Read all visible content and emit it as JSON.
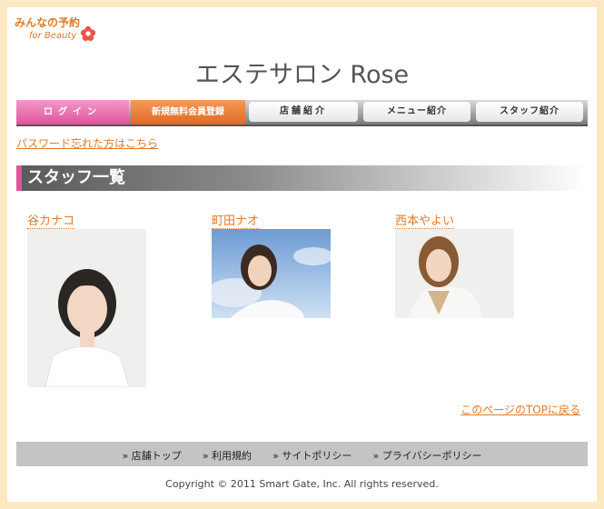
{
  "logo": {
    "main": "みんなの予約",
    "sub": "for Beauty"
  },
  "site_title": "エステサロン Rose",
  "nav": {
    "login": "ログイン",
    "register": "新規無料会員登録",
    "shop": "店舗紹介",
    "menu": "メニュー紹介",
    "staff": "スタッフ紹介"
  },
  "forgot_password": "パスワード忘れた方はこちら",
  "section_title": "スタッフ一覧",
  "staff": [
    {
      "name": "谷カナコ"
    },
    {
      "name": "町田ナオ"
    },
    {
      "name": "西本やよい"
    }
  ],
  "back_to_top": "このページのTOPに戻る",
  "footer_links": [
    "» 店舗トップ",
    "» 利用規約",
    "» サイトポリシー",
    "» プライバシーポリシー"
  ],
  "copyright": "Copyright © 2011 Smart Gate, Inc. All rights reserved.",
  "colors": {
    "accent_orange": "#e07a2a",
    "accent_pink": "#e0529a",
    "background": "#fde8c4"
  }
}
